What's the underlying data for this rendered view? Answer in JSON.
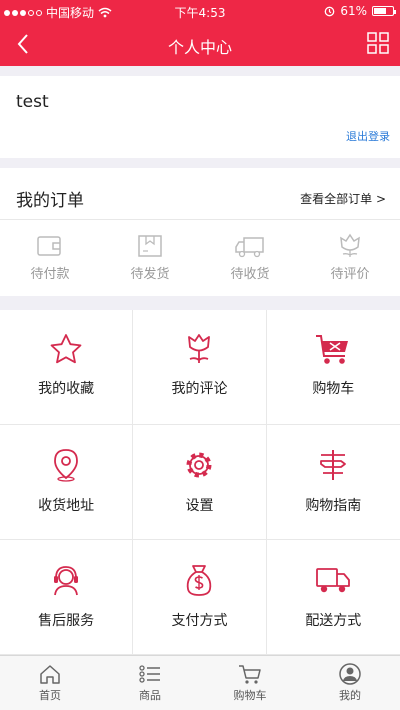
{
  "status_bar": {
    "carrier": "中国移动",
    "time": "下午4:53",
    "battery": "61%"
  },
  "nav": {
    "title": "个人中心"
  },
  "user": {
    "name": "test",
    "logout": "退出登录"
  },
  "orders": {
    "title": "我的订单",
    "view_all": "查看全部订单 >",
    "statuses": [
      {
        "label": "待付款",
        "icon": "wallet-icon"
      },
      {
        "label": "待发货",
        "icon": "package-icon"
      },
      {
        "label": "待收货",
        "icon": "truck-icon"
      },
      {
        "label": "待评价",
        "icon": "flower-icon"
      }
    ]
  },
  "menu": [
    {
      "label": "我的收藏",
      "icon": "star-icon"
    },
    {
      "label": "我的评论",
      "icon": "tulip-icon"
    },
    {
      "label": "购物车",
      "icon": "cart-icon"
    },
    {
      "label": "收货地址",
      "icon": "location-icon"
    },
    {
      "label": "设置",
      "icon": "gear-icon"
    },
    {
      "label": "购物指南",
      "icon": "guide-icon"
    },
    {
      "label": "售后服务",
      "icon": "headset-icon"
    },
    {
      "label": "支付方式",
      "icon": "moneybag-icon"
    },
    {
      "label": "配送方式",
      "icon": "delivery-truck-icon"
    }
  ],
  "tabbar": [
    {
      "label": "首页",
      "icon": "home-icon"
    },
    {
      "label": "商品",
      "icon": "list-icon"
    },
    {
      "label": "购物车",
      "icon": "cart-icon"
    },
    {
      "label": "我的",
      "icon": "user-icon"
    }
  ],
  "colors": {
    "accent": "#ee2746",
    "link": "#2b7bd8"
  }
}
